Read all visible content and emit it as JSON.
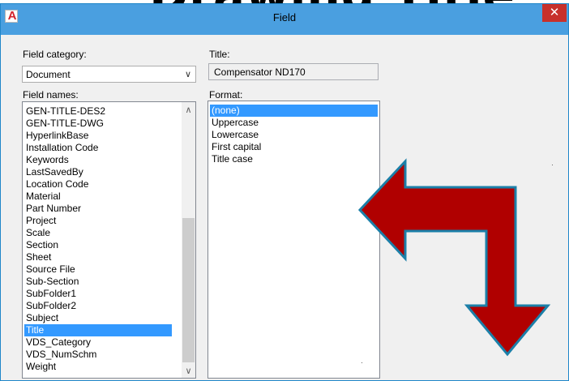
{
  "background_heading": "Drawing Title",
  "window": {
    "app_icon_letter": "A",
    "title": "Field",
    "close_glyph": "✕"
  },
  "field_category": {
    "label": "Field category:",
    "value": "Document"
  },
  "title_field": {
    "label": "Title:",
    "value": "Compensator ND170"
  },
  "field_names": {
    "label": "Field names:",
    "items": [
      "GEN-TITLE-DES2",
      "GEN-TITLE-DWG",
      "HyperlinkBase",
      "Installation Code",
      "Keywords",
      "LastSavedBy",
      "Location Code",
      "Material",
      "Part Number",
      "Project",
      "Scale",
      "Section",
      "Sheet",
      "Source File",
      "Sub-Section",
      "SubFolder1",
      "SubFolder2",
      "Subject",
      "Title",
      "VDS_Category",
      "VDS_NumSchm",
      "Weight"
    ],
    "selected": "Title"
  },
  "format": {
    "label": "Format:",
    "items": [
      "(none)",
      "Uppercase",
      "Lowercase",
      "First capital",
      "Title case"
    ],
    "selected": "(none)"
  },
  "icons": {
    "dropdown": "chevron-down-icon",
    "scroll_up": "scroll-up-arrow-icon",
    "scroll_down": "scroll-down-arrow-icon",
    "overlay": "bent-arrow-icon"
  },
  "colors": {
    "titlebar": "#4a9fe0",
    "close_button": "#c7302b",
    "selection": "#3399ff",
    "arrow_fill": "#b00000",
    "arrow_stroke": "#1b7fa8"
  }
}
